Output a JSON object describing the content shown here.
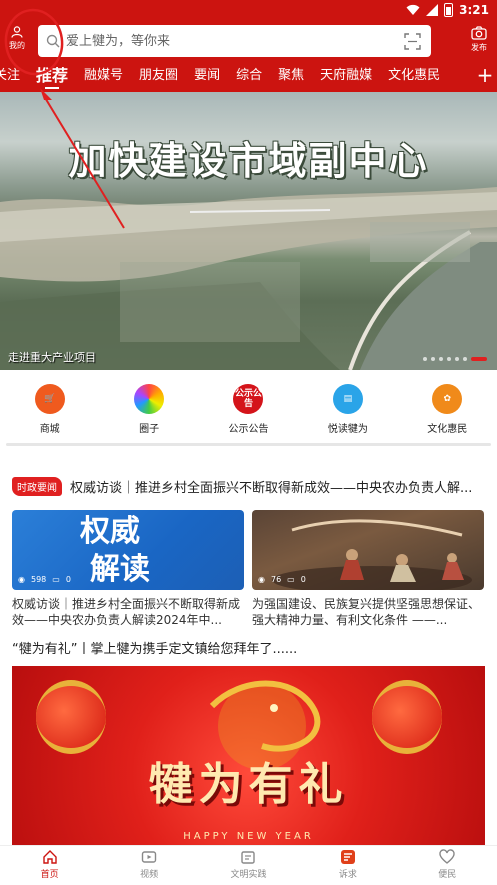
{
  "status_bar": {
    "time": "3:21",
    "battery_level": "2"
  },
  "header": {
    "me_label": "我的",
    "search_placeholder": "爱上犍为，等你来",
    "publish_label": "发布"
  },
  "tabs": [
    {
      "label": "关注"
    },
    {
      "label": "推荐",
      "active": true
    },
    {
      "label": "融媒号"
    },
    {
      "label": "朋友圈"
    },
    {
      "label": "要闻"
    },
    {
      "label": "综合"
    },
    {
      "label": "聚焦"
    },
    {
      "label": "天府融媒"
    },
    {
      "label": "文化惠民"
    }
  ],
  "tab_add_label": "+",
  "banner": {
    "title": "加快建设市域副中心",
    "caption": "走进重大产业项目"
  },
  "quick_links": [
    {
      "label": "商城",
      "icon": "shopping-cart-icon",
      "color": "#ef5a1e"
    },
    {
      "label": "圈子",
      "icon": "rainbow-circle-icon",
      "color": "#f2a20d"
    },
    {
      "label": "公示公告",
      "icon": "notice-icon",
      "color": "#d4141a",
      "icon_text": "公示公告"
    },
    {
      "label": "悦读犍为",
      "icon": "reading-icon",
      "color": "#2aa4e8"
    },
    {
      "label": "文化惠民",
      "icon": "culture-icon",
      "color": "#f08a1a"
    }
  ],
  "headline": {
    "badge": "时政要闻",
    "text": "权威访谈｜推进乡村全面振兴不断取得新成效——中央农办负责人解..."
  },
  "cards": [
    {
      "image_text_1": "权威",
      "image_text_2": "解读",
      "views": "598",
      "comments": "0",
      "title": "权威访谈｜推进乡村全面振兴不断取得新成效——中央农办负责人解读2024年中..."
    },
    {
      "views": "76",
      "comments": "0",
      "title": "为强国建设、民族复兴提供坚强思想保证、强大精神力量、有利文化条件 ——..."
    }
  ],
  "section2": {
    "title": "“犍为有礼”丨掌上犍为携手定文镇给您拜年了......",
    "banner_text": "犍为有礼",
    "banner_sub": "HAPPY NEW YEAR"
  },
  "bottom_nav": [
    {
      "label": "首页",
      "icon": "home-icon",
      "active": true
    },
    {
      "label": "视频",
      "icon": "video-icon"
    },
    {
      "label": "文明实践",
      "icon": "practice-icon"
    },
    {
      "label": "诉求",
      "icon": "appeal-icon"
    },
    {
      "label": "便民",
      "icon": "heart-icon"
    }
  ],
  "colors": {
    "brand_red": "#cc1410",
    "annotation_red": "#e02020"
  }
}
